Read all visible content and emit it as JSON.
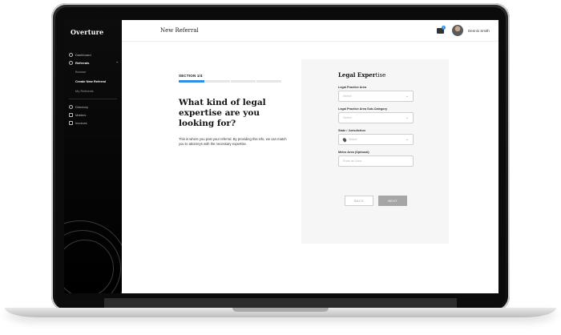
{
  "brand": "Overture",
  "header": {
    "title": "New Referral",
    "notification_count": "1",
    "user_name": "Dennis Smith"
  },
  "sidebar": {
    "items": [
      {
        "label": "Dashboard",
        "icon": "dashboard-icon"
      },
      {
        "label": "Referrals",
        "icon": "referrals-icon",
        "active": true
      },
      {
        "label": "Directory",
        "icon": "directory-icon"
      },
      {
        "label": "Matters",
        "icon": "matters-icon"
      },
      {
        "label": "Invoices",
        "icon": "invoices-icon"
      }
    ],
    "subitems": [
      {
        "label": "Browse"
      },
      {
        "label": "Create New Referral",
        "active": true
      },
      {
        "label": "My Referrals"
      }
    ]
  },
  "section": {
    "label": "SECTION 1/4",
    "progress": 0.25,
    "question": "What kind of legal expertise are you looking for?",
    "description": "This is where you post your referral. By providing this info, we can match you to attorneys with the necessary expertise."
  },
  "form": {
    "title_bold": "Legal Exper",
    "title_light": "tise",
    "fields": [
      {
        "label": "Legal Practice Area",
        "placeholder": "Select"
      },
      {
        "label": "Legal Practice Area Sub-Category",
        "placeholder": "Select"
      },
      {
        "label": "State / Jurisdiction",
        "placeholder": "Select"
      },
      {
        "label": "Metro Area (Optional)",
        "placeholder": "Enter an Area"
      }
    ],
    "back_label": "BACK",
    "next_label": "NEXT"
  },
  "colors": {
    "accent": "#2f8ee0",
    "sidebar_bg": "#000000",
    "button_disabled": "#a6a6a6"
  }
}
